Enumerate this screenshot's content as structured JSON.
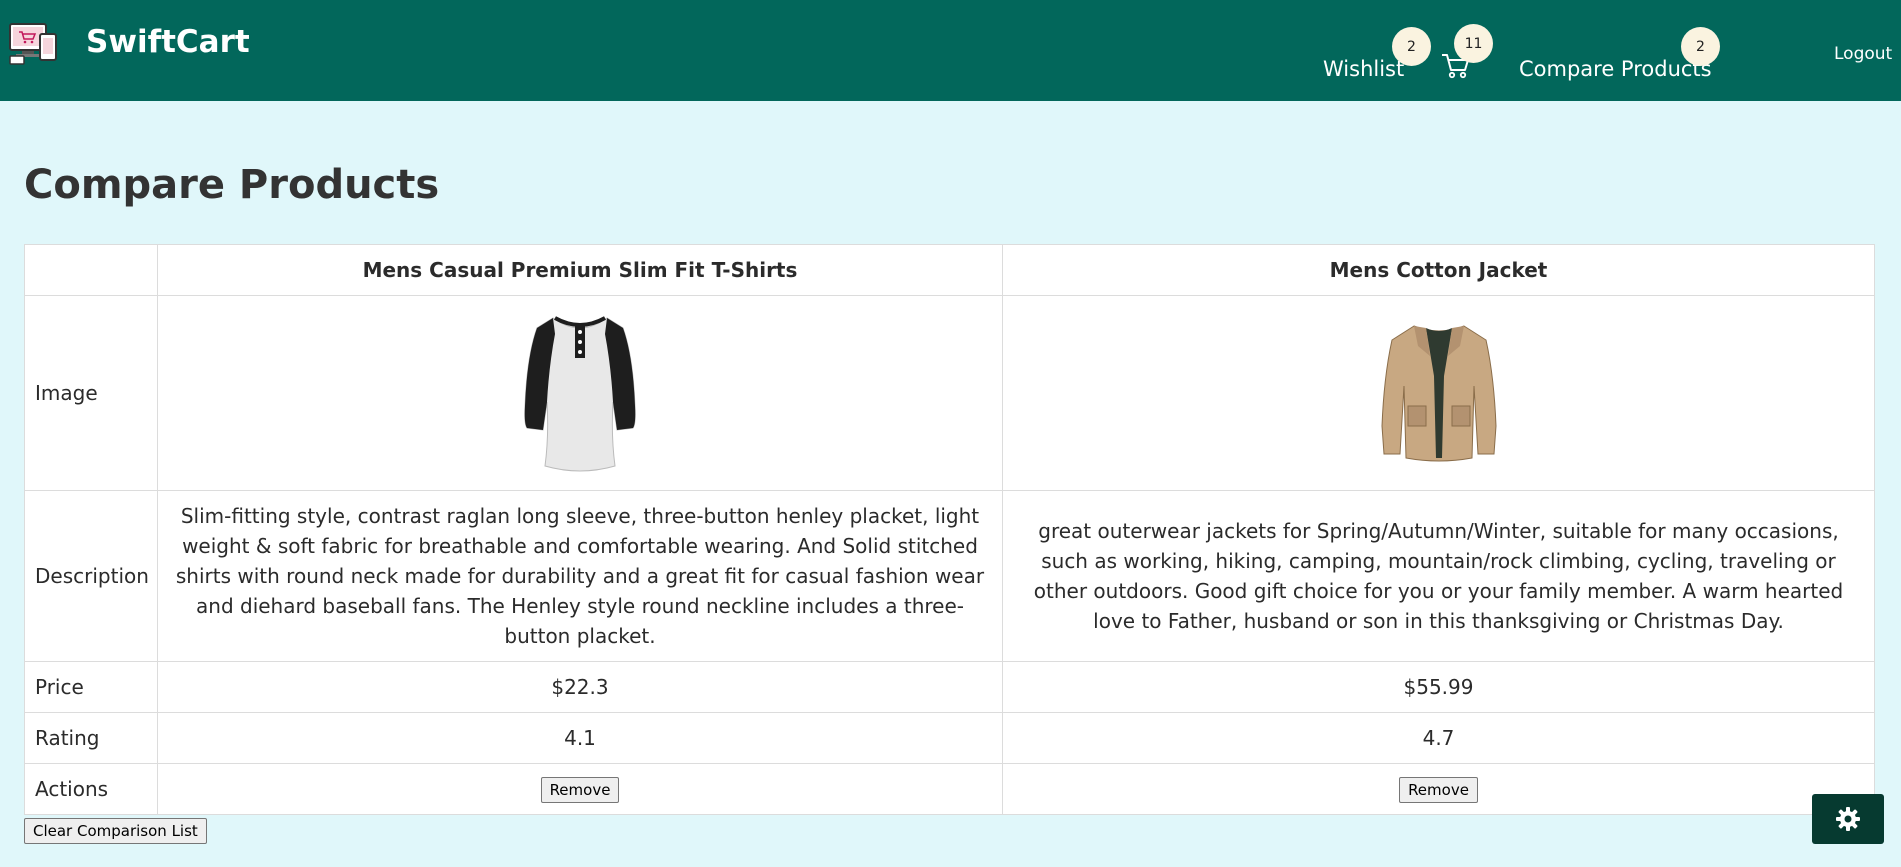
{
  "header": {
    "brand": "SwiftCart",
    "wishlist_label": "Wishlist",
    "wishlist_count": "2",
    "cart_count": "11",
    "compare_label": "Compare Products",
    "compare_count": "2",
    "logout_label": "Logout"
  },
  "page": {
    "title": "Compare Products"
  },
  "table": {
    "row_labels": {
      "image": "Image",
      "description": "Description",
      "price": "Price",
      "rating": "Rating",
      "actions": "Actions"
    },
    "products": [
      {
        "name": "Mens Casual Premium Slim Fit T-Shirts",
        "description": "Slim-fitting style, contrast raglan long sleeve, three-button henley placket, light weight & soft fabric for breathable and comfortable wearing. And Solid stitched shirts with round neck made for durability and a great fit for casual fashion wear and diehard baseball fans. The Henley style round neckline includes a three-button placket.",
        "price": "$22.3",
        "rating": "4.1",
        "remove_label": "Remove"
      },
      {
        "name": "Mens Cotton Jacket",
        "description": "great outerwear jackets for Spring/Autumn/Winter, suitable for many occasions, such as working, hiking, camping, mountain/rock climbing, cycling, traveling or other outdoors. Good gift choice for you or your family member. A warm hearted love to Father, husband or son in this thanksgiving or Christmas Day.",
        "price": "$55.99",
        "rating": "4.7",
        "remove_label": "Remove"
      }
    ]
  },
  "footer": {
    "clear_label": "Clear Comparison List"
  },
  "colors": {
    "header_bg": "#02675b",
    "page_bg": "#e0f7fa",
    "badge_bg": "#faf3e0",
    "settings_bg": "#063a30"
  },
  "icons": {
    "logo": "shop-devices-logo",
    "cart": "cart-icon",
    "settings": "gear-icon"
  }
}
